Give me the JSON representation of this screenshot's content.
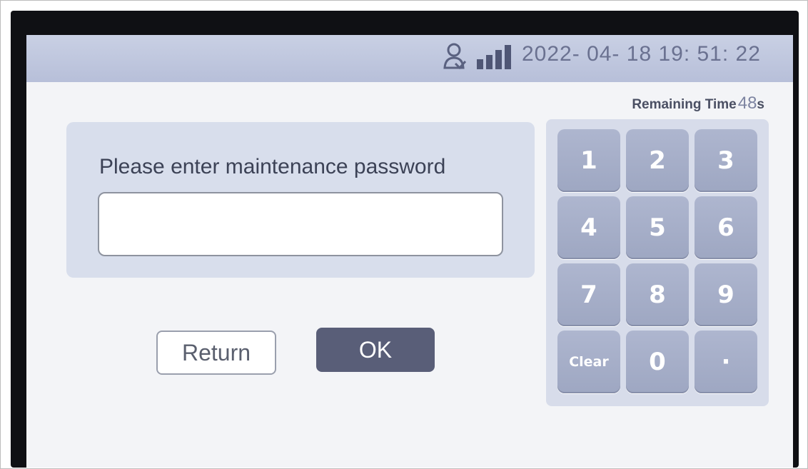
{
  "status_bar": {
    "user_icon": "user-icon",
    "signal_icon": "signal-bars-icon",
    "datetime": "2022- 04- 18  19: 51: 22"
  },
  "timer": {
    "label": "Remaining Time",
    "value": "48",
    "unit": "s"
  },
  "password": {
    "prompt": "Please enter maintenance password",
    "value": ""
  },
  "buttons": {
    "return_label": "Return",
    "ok_label": "OK"
  },
  "keypad": {
    "keys": [
      "1",
      "2",
      "3",
      "4",
      "5",
      "6",
      "7",
      "8",
      "9",
      "Clear",
      "0",
      "·"
    ]
  },
  "colors": {
    "status_bar": "#b7bfd9",
    "panel": "#d8deec",
    "key": "#a5adc8",
    "ok_button": "#595e78"
  }
}
